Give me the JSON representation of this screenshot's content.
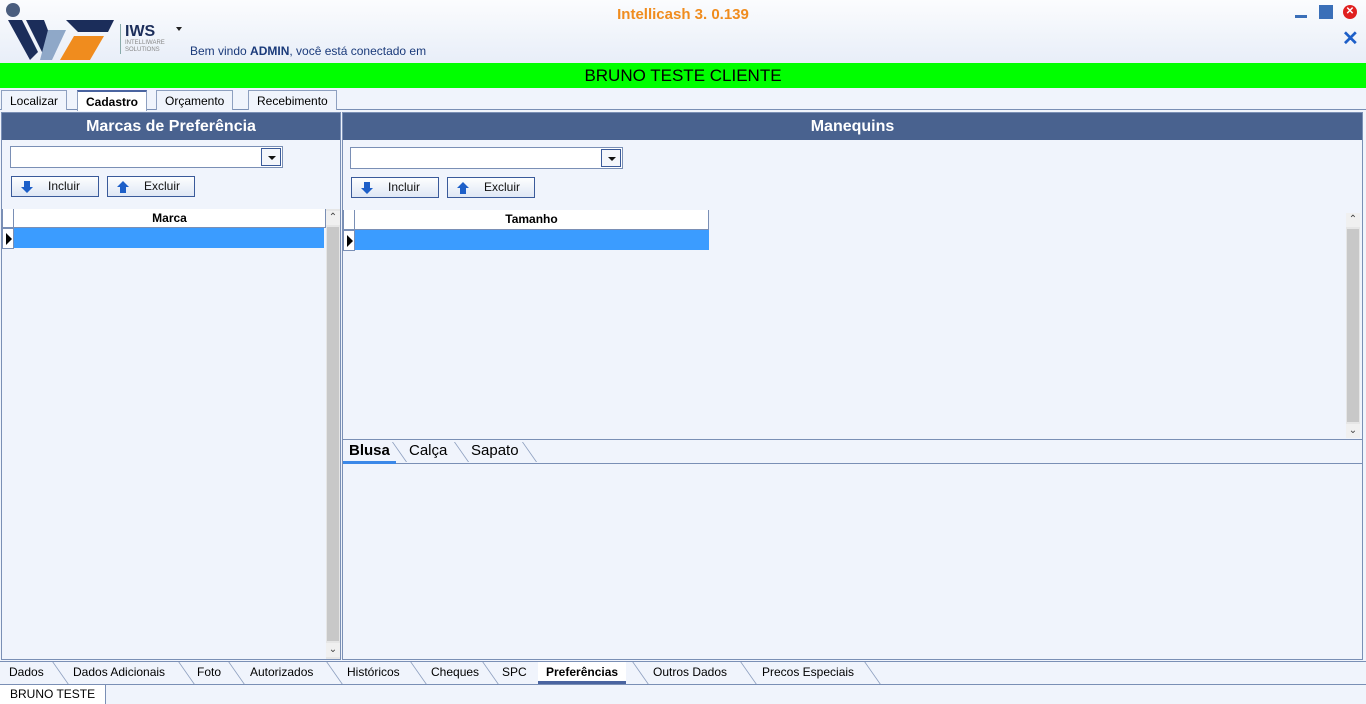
{
  "header": {
    "app_title": "Intellicash 3. 0.139",
    "logo_big": "IWS",
    "logo_small_1": "INTELLIWARE",
    "logo_small_2": "SOLUTIONS",
    "welcome_prefix": "Bem vindo ",
    "welcome_user": "ADMIN",
    "welcome_suffix": ", você está conectado em"
  },
  "client_name": "BRUNO TESTE CLIENTE",
  "top_tabs": [
    "Localizar",
    "Cadastro",
    "Orçamento",
    "Recebimento"
  ],
  "top_tab_active": "Cadastro",
  "left_panel": {
    "title": "Marcas de Preferência",
    "combo_value": "",
    "include_label": "Incluir",
    "exclude_label": "Excluir",
    "grid_header": "Marca"
  },
  "right_panel": {
    "title": "Manequins",
    "combo_value": "",
    "include_label": "Incluir",
    "exclude_label": "Excluir",
    "grid_header": "Tamanho",
    "sub_tabs": [
      "Blusa",
      "Calça",
      "Sapato"
    ],
    "sub_tab_active": "Blusa"
  },
  "bottom_tabs": [
    "Dados",
    "Dados Adicionais",
    "Foto",
    "Autorizados",
    "Históricos",
    "Cheques",
    "SPC",
    "Preferências",
    "Outros Dados",
    "Precos Especiais"
  ],
  "bottom_tab_active": "Preferências",
  "status": "BRUNO TESTE",
  "colors": {
    "accent_title": "#f08c1e",
    "client_bar": "#00ff00",
    "panel_header": "#49628f",
    "selected_row": "#3b9cff"
  }
}
